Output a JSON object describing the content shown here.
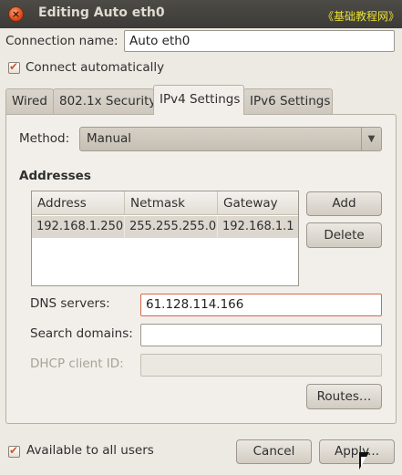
{
  "window": {
    "title": "Editing Auto eth0",
    "watermark": "《基础教程网》"
  },
  "connection": {
    "name_label": "Connection name:",
    "name_value": "Auto eth0",
    "auto_connect_label": "Connect automatically",
    "auto_connect_checked": true
  },
  "tabs": [
    {
      "label": "Wired",
      "active": false
    },
    {
      "label": "802.1x Security",
      "active": false
    },
    {
      "label": "IPv4 Settings",
      "active": true
    },
    {
      "label": "IPv6 Settings",
      "active": false
    }
  ],
  "ipv4": {
    "method_label": "Method:",
    "method_value": "Manual",
    "addresses_heading": "Addresses",
    "columns": [
      "Address",
      "Netmask",
      "Gateway"
    ],
    "rows": [
      [
        "192.168.1.250",
        "255.255.255.0",
        "192.168.1.1"
      ]
    ],
    "add_label": "Add",
    "delete_label": "Delete",
    "dns_label": "DNS servers:",
    "dns_value": "61.128.114.166",
    "search_label": "Search domains:",
    "search_value": "",
    "dhcp_label": "DHCP client ID:",
    "dhcp_value": "",
    "routes_label": "Routes…"
  },
  "footer": {
    "all_users_label": "Available to all users",
    "all_users_checked": true,
    "cancel_label": "Cancel",
    "apply_label": "Apply..."
  }
}
